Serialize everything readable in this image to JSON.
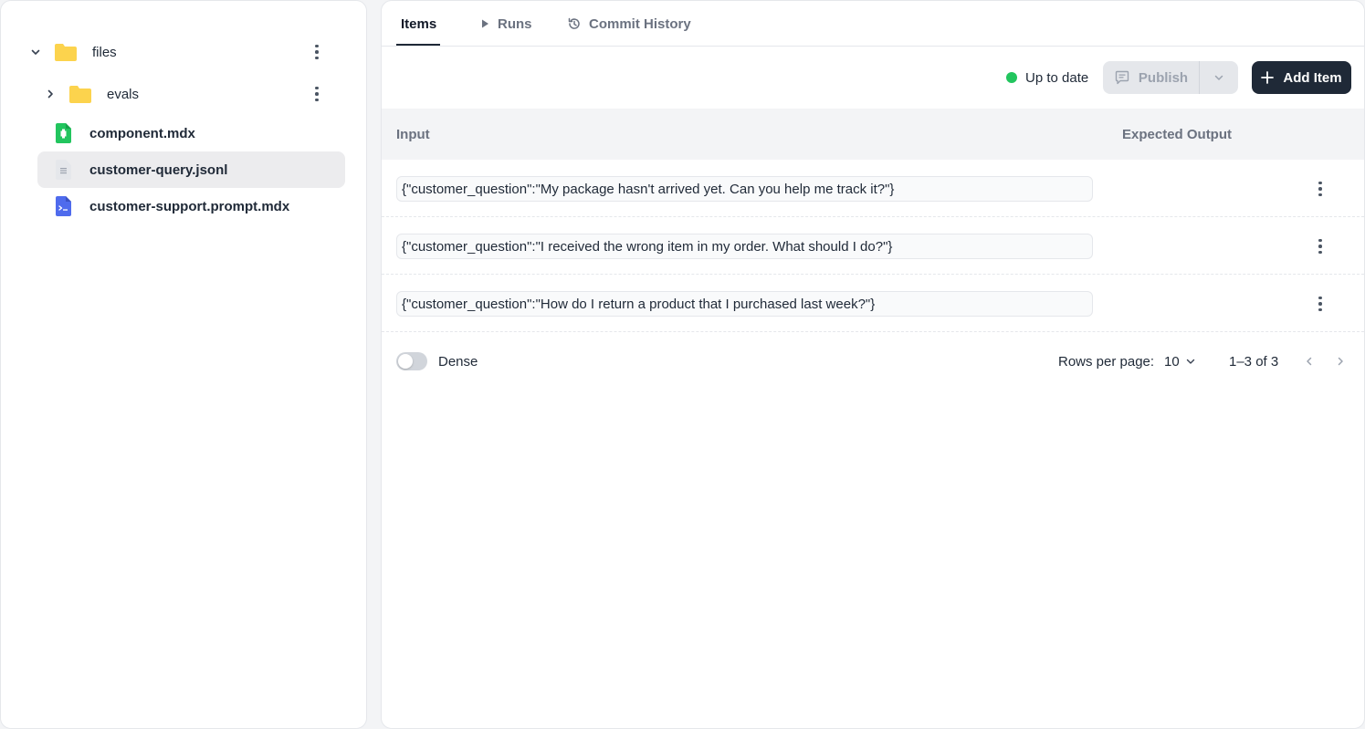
{
  "sidebar": {
    "tree": [
      {
        "label": "files",
        "icon": "folder-icon",
        "expanded": true
      },
      {
        "label": "evals",
        "icon": "folder-icon",
        "expanded": false
      },
      {
        "label": "component.mdx",
        "icon": "component-file-icon"
      },
      {
        "label": "customer-query.jsonl",
        "icon": "jsonl-file-icon",
        "selected": true
      },
      {
        "label": "customer-support.prompt.mdx",
        "icon": "prompt-file-icon"
      }
    ]
  },
  "tabs": [
    {
      "label": "Items",
      "active": true
    },
    {
      "label": "Runs",
      "icon": "play-icon"
    },
    {
      "label": "Commit History",
      "icon": "history-icon"
    }
  ],
  "toolbar": {
    "status_label": "Up to date",
    "status_color": "#22c55e",
    "publish_label": "Publish",
    "add_label": "Add Item"
  },
  "table": {
    "headers": [
      "Input",
      "Expected Output"
    ],
    "rows": [
      {
        "input": "{\"customer_question\":\"My package hasn't arrived yet. Can you help me track it?\"}",
        "expected_output": ""
      },
      {
        "input": "{\"customer_question\":\"I received the wrong item in my order. What should I do?\"}",
        "expected_output": ""
      },
      {
        "input": "{\"customer_question\":\"How do I return a product that I purchased last week?\"}",
        "expected_output": ""
      }
    ]
  },
  "footer": {
    "dense_label": "Dense",
    "dense_enabled": false,
    "rows_per_page_label": "Rows per page:",
    "rows_per_page_value": "10",
    "range_label": "1–3 of 3"
  },
  "colors": {
    "primary_dark": "#1f2937",
    "folder": "#fcd34d",
    "component_file": "#22c55e",
    "prompt_file": "#4f6bed"
  }
}
